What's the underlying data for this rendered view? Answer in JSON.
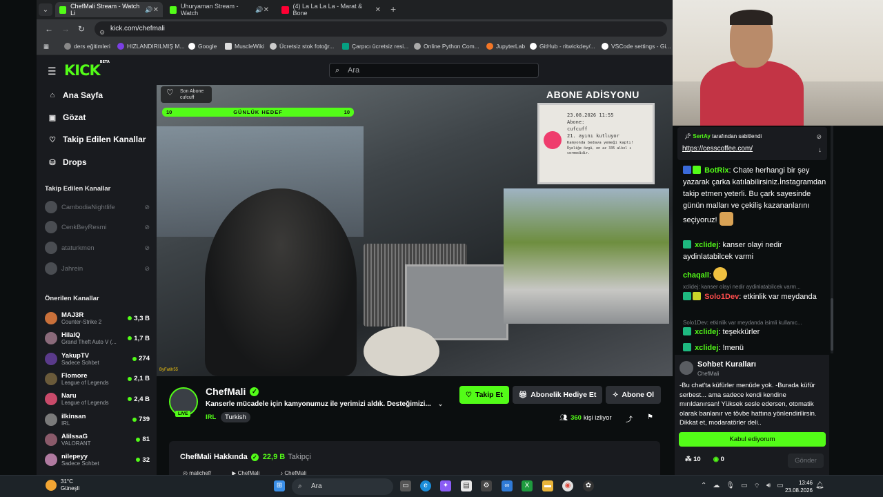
{
  "browser": {
    "tabs": [
      {
        "title": "ChefMali Stream - Watch Li"
      },
      {
        "title": "Uhuryaman Stream - Watch"
      },
      {
        "title": "(4) La La La La - Marat & Bone"
      }
    ],
    "url": "kick.com/chefmali",
    "bookmarks": [
      "ders eğitimleri",
      "HIZLANDIRILMIŞ M...",
      "Google",
      "MuscleWiki",
      "Ücretsiz stok fotoğr...",
      "Çarpıcı ücretsiz resi...",
      "Online Python Com...",
      "JupyterLab",
      "GitHub - ritwickdey/...",
      "VSCode settings - Gi..."
    ]
  },
  "header": {
    "logo": "KICK",
    "logo_tag": "BETA",
    "search_placeholder": "Ara"
  },
  "sidebar": {
    "nav": [
      "Ana Sayfa",
      "Gözat",
      "Takip Edilen Kanallar",
      "Drops"
    ],
    "followed_title": "Takip Edilen Kanallar",
    "followed": [
      "CambodiaNightlife",
      "CenkBeyResmi",
      "ataturkmen",
      "Jahrein"
    ],
    "recommended_title": "Önerilen Kanallar",
    "recommended": [
      {
        "name": "MAJ3R",
        "category": "Counter-Strike 2",
        "viewers": "3,3 B",
        "color": "#c9703a"
      },
      {
        "name": "HilalQ",
        "category": "Grand Theft Auto V (...",
        "viewers": "1,7 B",
        "color": "#8a6a7a"
      },
      {
        "name": "YakupTV",
        "category": "Sadece Sohbet",
        "viewers": "274",
        "color": "#5a3a8a"
      },
      {
        "name": "Flomore",
        "category": "League of Legends",
        "viewers": "2,1 B",
        "color": "#6a5a3a"
      },
      {
        "name": "Naru",
        "category": "League of Legends",
        "viewers": "2,4 B",
        "color": "#c94a6a"
      },
      {
        "name": "ilkinsan",
        "category": "IRL",
        "viewers": "739",
        "color": "#7a7a7a"
      },
      {
        "name": "AlilssaG",
        "category": "VALORANT",
        "viewers": "81",
        "color": "#8a5a6a"
      },
      {
        "name": "nilepeyy",
        "category": "Sadece Sohbet",
        "viewers": "32",
        "color": "#b07aa0"
      }
    ]
  },
  "video": {
    "last_sub_label": "Son Abone",
    "last_sub_user": "cufcuff",
    "goal_label": "GÜNLÜK HEDEF",
    "goal_left": "10",
    "goal_right": "10",
    "goal_progress": 1.0,
    "receipt_title": "ABONE ADİSYONU",
    "receipt_lines": [
      "23.08.2026 11:55",
      "Abone:",
      "cufcuff",
      "21. ayını kutluyor",
      "Kamyonda bedava yemeği kaptı!",
      "Üyeliğe özgü, en az 335 alkol ı cermedidir."
    ],
    "watermark": "ByFatih55"
  },
  "channel": {
    "name": "ChefMali",
    "live": "LIVE",
    "title": "Kanserle mücadele için kamyonumuz ile yerimizi aldık. Desteğimizi...",
    "category": "IRL",
    "language": "Turkish",
    "follow_label": "Takip Et",
    "gift_label": "Abonelik Hediye Et",
    "subscribe_label": "Abone Ol",
    "viewer_count": "360",
    "viewer_suffix": "kişi izliyor",
    "about_title": "ChefMali Hakkında",
    "followers_count": "22,9 B",
    "followers_label": "Takipçi",
    "socials": [
      "malichef/",
      "ChefMali",
      "ChefMali"
    ]
  },
  "chat": {
    "pinned_by_name": "SertAy",
    "pinned_by_suffix": "tarafından sabitlendi",
    "pinned_link": "https://cesscoffee.com/",
    "messages": [
      {
        "user": "BotRix",
        "color": "#53fc18",
        "text": "Chate herhangi bir şey yazarak çarka katılabilirsiniz.İnstagramdan takip etmen yeterli. Bu çark sayesinde günün malları ve çekiliş kazananlarını seçiyoruz!"
      },
      {
        "user": "xclidej",
        "color": "#53fc18",
        "text": "kanser olayi nedir aydinlatabilcek varmi"
      },
      {
        "user": "chaqall",
        "color": "#53fc18",
        "text": ""
      },
      {
        "reply": "xclidej: kanser olayi nedir aydinlatabilcek varm..."
      },
      {
        "user": "Solo1Dev",
        "color": "#ff4d4d",
        "text": "etkinlik var meydanda"
      },
      {
        "reply": "Solo1Dev: etkinlik var meydanda isimli kullanıc..."
      },
      {
        "user": "xclidej",
        "color": "#53fc18",
        "text": "teşekkürler"
      },
      {
        "user": "xclidej",
        "color": "#53fc18",
        "text": "!menü"
      }
    ],
    "rules_title": "Sohbet Kuralları",
    "rules_channel": "ChefMali",
    "rules_text": "-Bu chat'ta küfürler menüde yok. -Burada küfür serbest... ama sadece kendi kendine mırıldanırsan! Yüksek sesle edersen, otomatik olarak banlanır ve tövbe hattına yönlendirilirsin. Dikkat et, modaratörler deli..",
    "accept_label": "Kabul ediyorum",
    "foot_left": "10",
    "foot_right": "0",
    "send_label": "Gönder"
  },
  "taskbar": {
    "temp": "31°C",
    "weather": "Güneşli",
    "search": "Ara",
    "time": "13:46",
    "date": "23.08.2026"
  }
}
